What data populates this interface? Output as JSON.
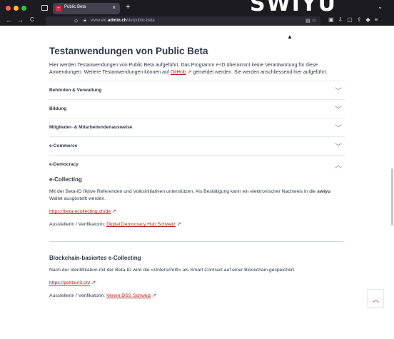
{
  "browser": {
    "tab_title": "Public Beta",
    "tab_close": "×",
    "new_tab": "+",
    "tab_overflow": "⌄",
    "url_prefix": "www.eid.",
    "url_domain": "admin.ch",
    "url_path": "/de/public-beta",
    "nav_back": "←",
    "nav_forward": "→",
    "nav_reload": "C",
    "shield_icon": "🛡",
    "lock_icon": "🔒",
    "bg_art_text": "SWIYU"
  },
  "page": {
    "title": "Testanwendungen von Public Beta",
    "intro_part1": "Hier werden Testanwendungen von Public Beta aufgeführt. Das Programm e-ID übernimmt keine Verantwortung für diese Anwendungen. Weitere Testanwendungen können auf ",
    "intro_link": "GitHub",
    "intro_part2": " gemeldet werden. Sie werden anschliessend hier aufgeführt.",
    "accordion": [
      {
        "label": "Behörden & Verwaltung",
        "expanded": false
      },
      {
        "label": "Bildung",
        "expanded": false
      },
      {
        "label": "Mitglieder- & Mitarbeitendenausweise",
        "expanded": false
      },
      {
        "label": "e-Commerce",
        "expanded": false
      },
      {
        "label": "e-Democracy",
        "expanded": true
      }
    ],
    "chevron_down": "﹀",
    "chevron_up": "︿",
    "apps": [
      {
        "title": "e-Collecting",
        "desc_part1": "Mit der Beta-ID fiktive Referenden und Volksinitiativen unterstützen. Als Bestätigung kann ein elektronischer Nachweis in die ",
        "desc_bold": "swiyu",
        "desc_part2": " Wallet ausgestellt werden.",
        "url": "https://beta.ecollecting.ch/de",
        "issuer_label": "Ausstellerin / Verifikatorin: ",
        "issuer": "Digital Democracy Hub Schweiz"
      },
      {
        "title": "Blockchain-basiertes e-Collecting",
        "desc_part1": "Nach der Identifikation mit der Beta-ID wird die «Unterschrift» als Smart Contract auf einer Blockchain gespeichert.",
        "url": "https://petition3.ch/",
        "issuer_label": "Ausstellerin / Verifikatorin: ",
        "issuer": "Verein DSS Schweiz"
      }
    ],
    "back_to_top": "︿"
  },
  "colors": {
    "link": "#b91c1c",
    "text": "#2d3748",
    "chrome": "#1c1b22"
  }
}
